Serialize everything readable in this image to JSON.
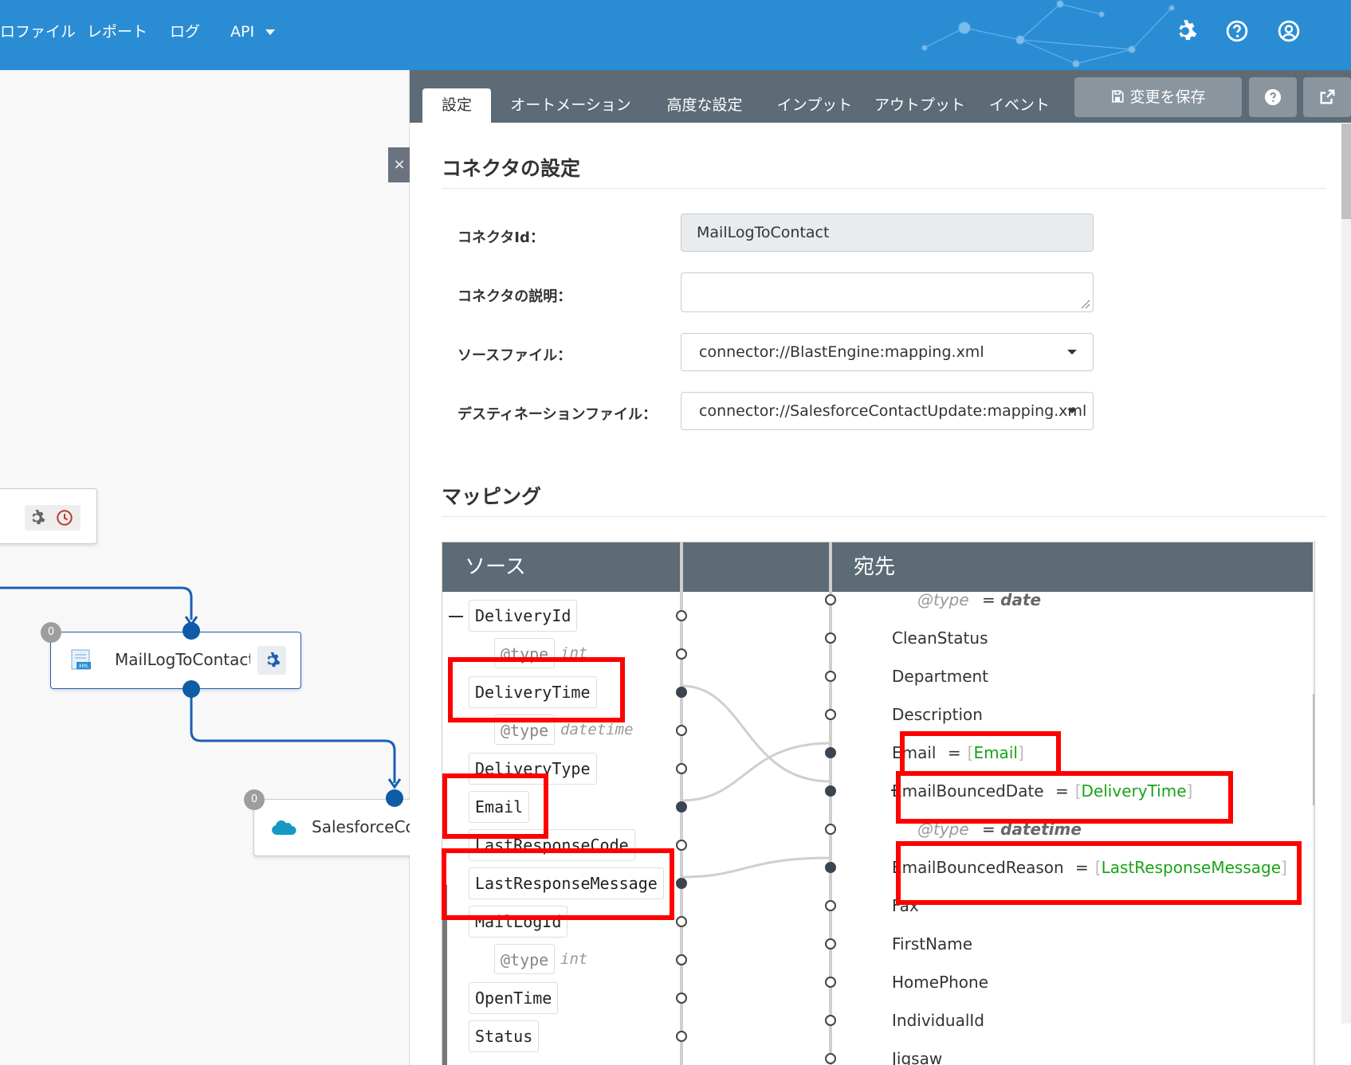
{
  "topnav": {
    "items": [
      {
        "label": "ロファイル"
      },
      {
        "label": "レポート"
      },
      {
        "label": "ログ"
      },
      {
        "label": "API"
      }
    ],
    "icons": [
      "gear-icon",
      "help-icon",
      "user-icon"
    ]
  },
  "flow": {
    "node_main": {
      "label": "MailLogToContact",
      "badge": "0"
    },
    "node_sf": {
      "label": "SalesforceCo...",
      "badge": "0"
    }
  },
  "close_label": "×",
  "tabs": [
    {
      "label": "設定"
    },
    {
      "label": "オートメーション"
    },
    {
      "label": "高度な設定"
    },
    {
      "label": "インプット"
    },
    {
      "label": "アウトプット"
    },
    {
      "label": "イベント"
    }
  ],
  "active_tab": "設定",
  "save_label": "変更を保存",
  "settings": {
    "heading": "コネクタの設定",
    "connector_id_label": "コネクタId：",
    "connector_id_value": "MailLogToContact",
    "description_label": "コネクタの説明：",
    "description_value": "",
    "source_label": "ソースファイル：",
    "source_value": "connector://BlastEngine:mapping.xml",
    "dest_label": "デスティネーションファイル：",
    "dest_value": "connector://SalesforceContactUpdate:mapping.xml"
  },
  "mapping": {
    "heading": "マッピング",
    "source_header": "ソース",
    "dest_header": "宛先",
    "source_nodes": [
      {
        "name": "DeliveryId"
      },
      {
        "type_attr": "@type",
        "type_val": "int"
      },
      {
        "name": "DeliveryTime"
      },
      {
        "type_attr": "@type",
        "type_val": "datetime"
      },
      {
        "name": "DeliveryType"
      },
      {
        "name": "Email"
      },
      {
        "name": "LastResponseCode"
      },
      {
        "name": "LastResponseMessage"
      },
      {
        "name": "MailLogId"
      },
      {
        "type_attr": "@type",
        "type_val": "int"
      },
      {
        "name": "OpenTime"
      },
      {
        "name": "Status"
      }
    ],
    "dest_nodes": [
      {
        "type_attr": "@type",
        "type_val": "date"
      },
      {
        "name": "CleanStatus"
      },
      {
        "name": "Department"
      },
      {
        "name": "Description"
      },
      {
        "name": "Email",
        "mapped": "Email"
      },
      {
        "name": "EmailBouncedDate",
        "mapped": "DeliveryTime"
      },
      {
        "type_attr": "@type",
        "type_val": "datetime"
      },
      {
        "name": "EmailBouncedReason",
        "mapped": "LastResponseMessage"
      },
      {
        "name": "Fax"
      },
      {
        "name": "FirstName"
      },
      {
        "name": "HomePhone"
      },
      {
        "name": "IndividualId"
      },
      {
        "name": "Jigsaw"
      }
    ],
    "eq": "=",
    "lbr": "[",
    "rbr": "]"
  },
  "colors": {
    "topbar": "#2a8dd4",
    "tabbar": "#5c6b75",
    "highlight": "#ff0000",
    "mapped_text": "#19a319"
  }
}
